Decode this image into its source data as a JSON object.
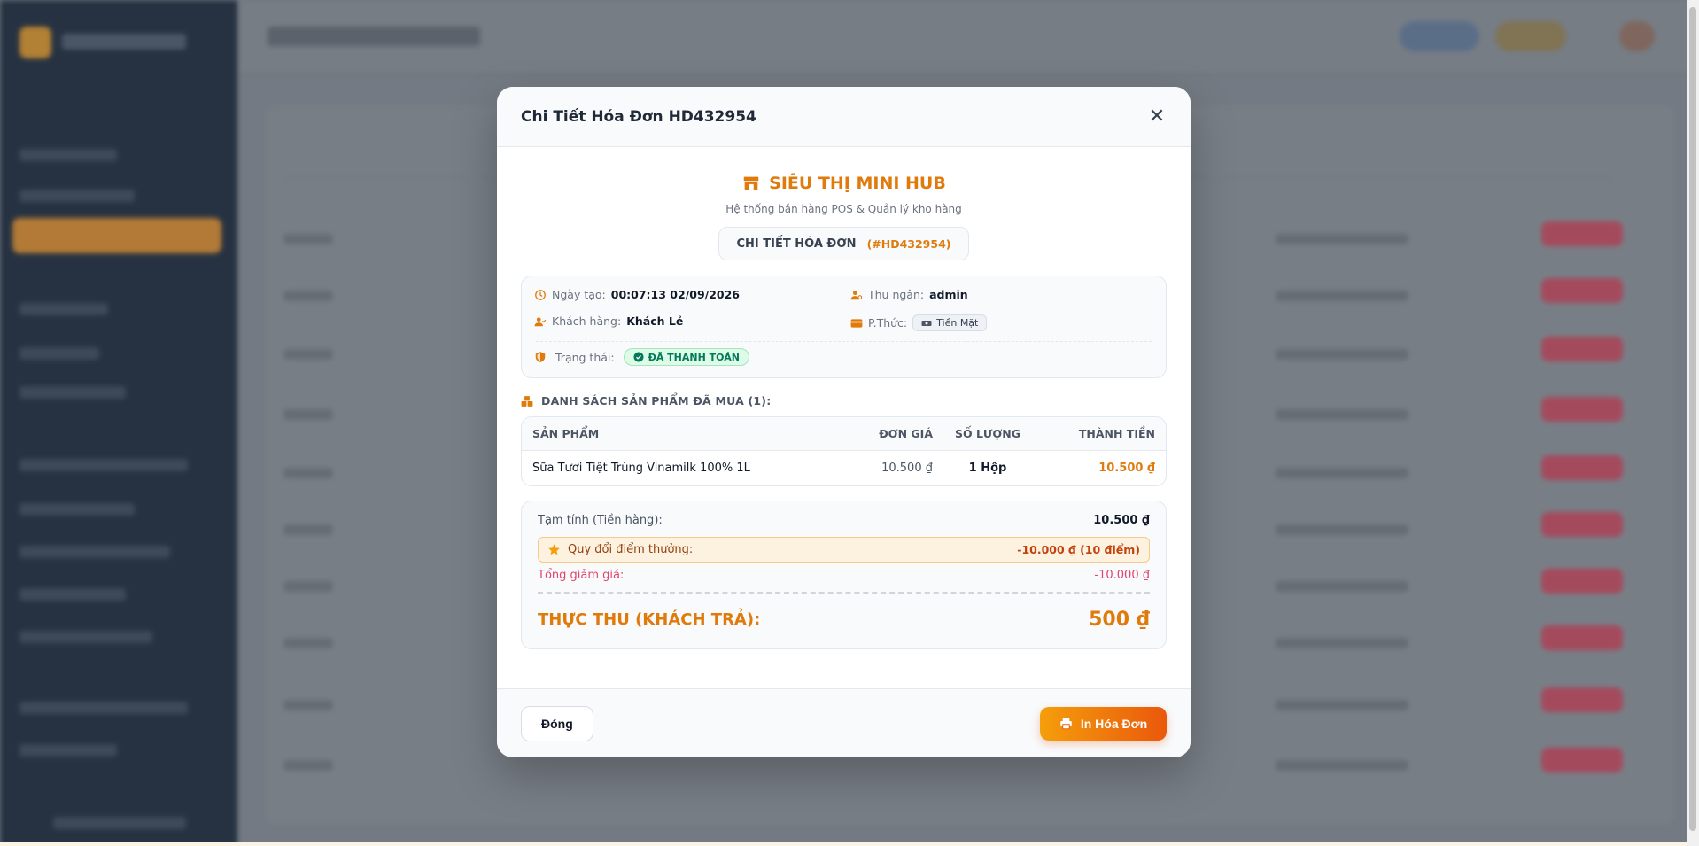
{
  "modal": {
    "title": "Chi Tiết Hóa Đơn HD432954",
    "close_icon": "close-icon"
  },
  "store": {
    "name": "SIÊU THỊ MINI HUB",
    "subtitle": "Hệ thống bán hàng POS & Quản lý kho hàng",
    "doc_label": "CHI TIẾT HÓA ĐƠN",
    "doc_code": "(#HD432954)"
  },
  "info": {
    "created_label": "Ngày tạo:",
    "created_value": "00:07:13 02/09/2026",
    "cashier_label": "Thu ngân:",
    "cashier_value": "admin",
    "customer_label": "Khách hàng:",
    "customer_value": "Khách Lẻ",
    "method_label": "P.Thức:",
    "method_value": "Tiền Mặt",
    "status_label": "Trạng thái:",
    "status_value": "ĐÃ THANH TOÁN"
  },
  "products": {
    "section_title": "DANH SÁCH SẢN PHẨM ĐÃ MUA (1):",
    "headers": {
      "name": "SẢN PHẨM",
      "price": "ĐƠN GIÁ",
      "qty": "SỐ LƯỢNG",
      "total": "THÀNH TIỀN"
    },
    "rows": [
      {
        "name": "Sữa Tươi Tiệt Trùng Vinamilk 100% 1L",
        "price": "10.500 ₫",
        "qty": "1 Hộp",
        "total": "10.500 ₫"
      }
    ]
  },
  "summary": {
    "subtotal_label": "Tạm tính (Tiền hàng):",
    "subtotal_value": "10.500 ₫",
    "points_label": "Quy đổi điểm thưởng:",
    "points_value": "-10.000 ₫ (10 điểm)",
    "discount_label": "Tổng giảm giá:",
    "discount_value": "-10.000 ₫",
    "total_label": "THỰC THU (KHÁCH TRẢ):",
    "total_value": "500 ₫"
  },
  "footer": {
    "close_label": "Đóng",
    "print_label": "In Hóa Đơn"
  },
  "colors": {
    "accent": "#e07a0b",
    "success": "#047857",
    "discount": "#e0456b"
  }
}
